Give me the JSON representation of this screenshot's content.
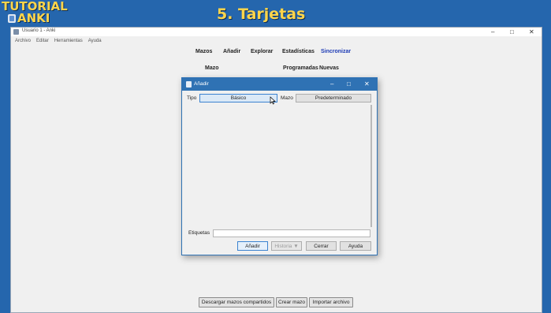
{
  "banner": {
    "logo_line1": "TUTORIAL",
    "logo_line2": "ANKI",
    "title": "5. Tarjetas"
  },
  "main_window": {
    "title": "Usuario 1 - Anki",
    "menu": [
      "Archivo",
      "Editar",
      "Herramientas",
      "Ayuda"
    ],
    "toolbar": {
      "decks": "Mazos",
      "add": "Añadir",
      "browse": "Explorar",
      "stats": "Estadísticas",
      "sync": "Sincronizar"
    },
    "deck_header": {
      "deck": "Mazo",
      "due": "Programadas",
      "new": "Nuevas"
    },
    "bottom_buttons": {
      "shared": "Descargar mazos compartidos",
      "create": "Crear mazo",
      "import": "Importar archivo"
    }
  },
  "add_dialog": {
    "title": "Añadir",
    "type_label": "Tipo",
    "type_value": "Básico",
    "deck_label": "Mazo",
    "deck_value": "Predeterminado",
    "tags_label": "Etiquetas",
    "tags_value": "",
    "buttons": {
      "add": "Añadir",
      "history": "Historia ▼",
      "close": "Cerrar",
      "help": "Ayuda"
    }
  },
  "colors": {
    "background": "#2566ad",
    "banner_text": "#ffd54a",
    "dialog_titlebar": "#2f72b4",
    "sync_link": "#1d3bb5"
  }
}
